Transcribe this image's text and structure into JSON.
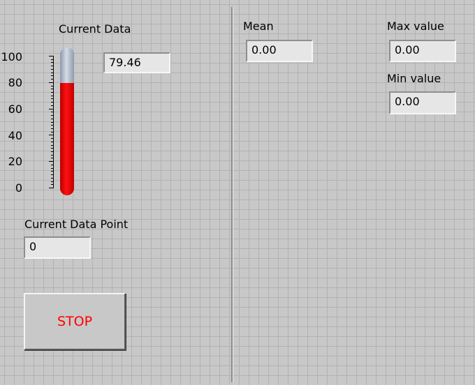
{
  "thermometer": {
    "label": "Current Data",
    "value": 79.46,
    "value_text": "79.46",
    "range": [
      0,
      100
    ],
    "ticks": [
      "0",
      "20",
      "40",
      "60",
      "80",
      "100"
    ],
    "fill_color": "#ee0000",
    "empty_color": "#a9b3c4"
  },
  "data_point": {
    "label": "Current Data Point",
    "value": "0"
  },
  "stop_button": {
    "label": "STOP",
    "color": "#ff0000"
  },
  "stats": {
    "mean": {
      "label": "Mean",
      "value": "0.00"
    },
    "max": {
      "label": "Max value",
      "value": "0.00"
    },
    "min": {
      "label": "Min value",
      "value": "0.00"
    }
  }
}
